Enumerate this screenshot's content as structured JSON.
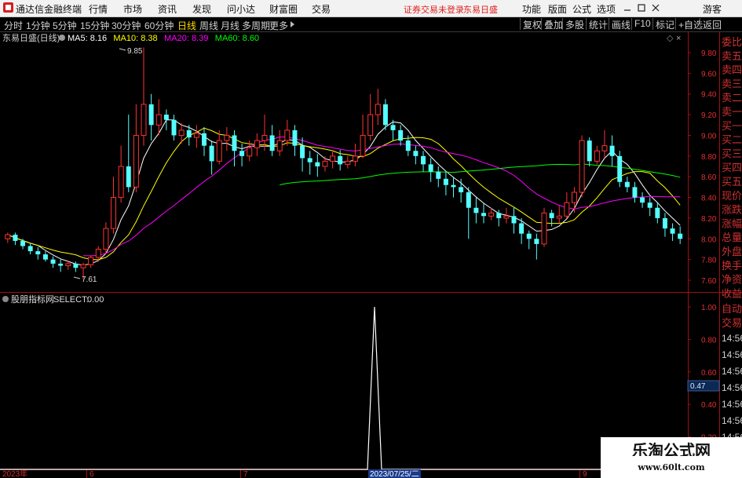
{
  "app": {
    "name": "通达信金融终端",
    "menu": [
      "行情",
      "市场",
      "资讯",
      "发现",
      "问小达",
      "财富圈",
      "交易"
    ],
    "warning": "证券交易未登录",
    "stock_short": "东易日盛",
    "right_menu": [
      "功能",
      "版面",
      "公式",
      "选项"
    ],
    "guest": "游客"
  },
  "toolbar": {
    "periods": [
      "分时",
      "1分钟",
      "5分钟",
      "15分钟",
      "30分钟",
      "60分钟",
      "日线",
      "周线",
      "月线",
      "多周期",
      "更多"
    ],
    "active_period": "日线",
    "buttons": [
      "复权",
      "叠加",
      "多股",
      "统计",
      "画线",
      "F10",
      "标记",
      "+自选",
      "返回"
    ]
  },
  "main_chart": {
    "title": "东易日盛(日线)",
    "ma": [
      {
        "label": "MA5:",
        "value": "8.16",
        "color": "#ffffff"
      },
      {
        "label": "MA10:",
        "value": "8.38",
        "color": "#ffff00"
      },
      {
        "label": "MA20:",
        "value": "8.39",
        "color": "#ff00ff"
      },
      {
        "label": "MA60:",
        "value": "8.60",
        "color": "#00ff00"
      }
    ],
    "high_label": "9.85",
    "low_label": "7.61"
  },
  "sub_chart": {
    "title": "股朋指标网",
    "select_label": "SELECT:",
    "select_value": "0.00",
    "current_value": "0.47"
  },
  "side_panel": {
    "labels": [
      "委比",
      "卖五",
      "卖四",
      "卖三",
      "卖二",
      "卖一",
      "买一",
      "买二",
      "买三",
      "买四",
      "买五",
      "现价",
      "涨跌",
      "涨幅",
      "总量",
      "外盘",
      "换手",
      "净资",
      "收益"
    ],
    "sub_labels": [
      "自动",
      "交易"
    ],
    "times": [
      "14:56",
      "14:56",
      "14:56",
      "14:56",
      "14:56",
      "14:56",
      "14:56",
      "14:56"
    ]
  },
  "x_axis": {
    "ticks": [
      "2023年",
      "6",
      "7",
      "9"
    ],
    "cursor_date": "2023/07/25/二"
  },
  "watermark": {
    "title": "乐淘公式网",
    "url": "www.60lt.com"
  },
  "chart_data": {
    "type": "candlestick",
    "title": "东易日盛(日线)",
    "ylim": [
      7.5,
      10.0
    ],
    "y_ticks": [
      9.8,
      9.6,
      9.4,
      9.2,
      9.0,
      8.8,
      8.6,
      8.4,
      8.2,
      8.0,
      7.8,
      7.6
    ],
    "candles": [
      [
        8.0,
        8.04,
        7.96,
        8.06
      ],
      [
        8.04,
        7.98,
        7.94,
        8.06
      ],
      [
        7.98,
        7.93,
        7.9,
        8.0
      ],
      [
        7.93,
        7.88,
        7.85,
        7.96
      ],
      [
        7.88,
        7.85,
        7.8,
        7.92
      ],
      [
        7.85,
        7.8,
        7.78,
        7.88
      ],
      [
        7.8,
        7.76,
        7.72,
        7.83
      ],
      [
        7.76,
        7.74,
        7.68,
        7.8
      ],
      [
        7.74,
        7.76,
        7.7,
        7.79
      ],
      [
        7.76,
        7.72,
        7.68,
        7.78
      ],
      [
        7.72,
        7.75,
        7.61,
        7.77
      ],
      [
        7.75,
        7.82,
        7.72,
        7.84
      ],
      [
        7.82,
        7.9,
        7.78,
        7.93
      ],
      [
        7.9,
        8.1,
        7.86,
        8.16
      ],
      [
        8.1,
        8.4,
        8.05,
        8.6
      ],
      [
        8.4,
        8.7,
        8.35,
        8.9
      ],
      [
        8.7,
        8.5,
        8.45,
        9.2
      ],
      [
        8.5,
        9.0,
        8.45,
        9.3
      ],
      [
        9.0,
        9.3,
        8.9,
        9.85
      ],
      [
        9.3,
        9.1,
        8.95,
        9.4
      ],
      [
        9.1,
        9.2,
        9.0,
        9.35
      ],
      [
        9.2,
        9.15,
        9.05,
        9.25
      ],
      [
        9.15,
        9.0,
        8.95,
        9.2
      ],
      [
        9.0,
        9.05,
        8.92,
        9.12
      ],
      [
        9.05,
        8.98,
        8.9,
        9.1
      ],
      [
        8.98,
        9.02,
        8.88,
        9.1
      ],
      [
        9.02,
        8.9,
        8.8,
        9.08
      ],
      [
        8.9,
        8.75,
        8.62,
        8.95
      ],
      [
        8.75,
        8.95,
        8.72,
        9.05
      ],
      [
        8.95,
        9.0,
        8.85,
        9.08
      ],
      [
        9.0,
        8.85,
        8.7,
        9.05
      ],
      [
        8.85,
        8.8,
        8.7,
        8.92
      ],
      [
        8.8,
        8.88,
        8.75,
        8.95
      ],
      [
        8.88,
        8.95,
        8.8,
        9.02
      ],
      [
        8.95,
        9.0,
        8.85,
        9.2
      ],
      [
        9.0,
        8.85,
        8.8,
        9.1
      ],
      [
        8.85,
        8.95,
        8.8,
        9.05
      ],
      [
        8.95,
        9.05,
        8.9,
        9.15
      ],
      [
        9.05,
        8.9,
        8.8,
        9.1
      ],
      [
        8.9,
        8.78,
        8.65,
        8.98
      ],
      [
        8.78,
        8.74,
        8.62,
        8.85
      ],
      [
        8.74,
        8.7,
        8.6,
        8.82
      ],
      [
        8.7,
        8.75,
        8.65,
        8.8
      ],
      [
        8.75,
        8.8,
        8.68,
        8.86
      ],
      [
        8.8,
        8.72,
        8.66,
        8.86
      ],
      [
        8.72,
        8.75,
        8.68,
        8.8
      ],
      [
        8.75,
        8.8,
        8.7,
        8.92
      ],
      [
        8.8,
        9.0,
        8.78,
        9.2
      ],
      [
        9.0,
        9.2,
        8.95,
        9.4
      ],
      [
        9.2,
        9.3,
        9.1,
        9.45
      ],
      [
        9.3,
        9.1,
        9.05,
        9.35
      ],
      [
        9.1,
        9.05,
        8.95,
        9.15
      ],
      [
        9.05,
        8.95,
        8.9,
        9.1
      ],
      [
        8.95,
        8.85,
        8.8,
        9.0
      ],
      [
        8.85,
        8.8,
        8.72,
        8.9
      ],
      [
        8.8,
        8.72,
        8.65,
        8.85
      ],
      [
        8.72,
        8.65,
        8.55,
        8.78
      ],
      [
        8.65,
        8.58,
        8.5,
        8.7
      ],
      [
        8.58,
        8.52,
        8.42,
        8.65
      ],
      [
        8.52,
        8.5,
        8.4,
        8.6
      ],
      [
        8.5,
        8.45,
        8.35,
        8.58
      ],
      [
        8.45,
        8.3,
        8.0,
        8.5
      ],
      [
        8.3,
        8.25,
        8.15,
        8.4
      ],
      [
        8.25,
        8.22,
        8.15,
        8.35
      ],
      [
        8.22,
        8.25,
        8.18,
        8.3
      ],
      [
        8.25,
        8.2,
        8.12,
        8.28
      ],
      [
        8.2,
        8.22,
        8.15,
        8.3
      ],
      [
        8.22,
        8.15,
        8.05,
        8.3
      ],
      [
        8.15,
        8.05,
        7.95,
        8.2
      ],
      [
        8.05,
        8.0,
        7.9,
        8.08
      ],
      [
        8.0,
        7.95,
        7.8,
        8.05
      ],
      [
        7.95,
        8.25,
        7.92,
        8.3
      ],
      [
        8.25,
        8.2,
        8.12,
        8.28
      ],
      [
        8.2,
        8.22,
        8.15,
        8.32
      ],
      [
        8.22,
        8.35,
        8.2,
        8.45
      ],
      [
        8.35,
        8.45,
        8.25,
        8.5
      ],
      [
        8.45,
        8.95,
        8.4,
        9.0
      ],
      [
        8.95,
        8.75,
        8.7,
        8.98
      ],
      [
        8.75,
        8.85,
        8.72,
        8.9
      ],
      [
        8.85,
        8.9,
        8.78,
        9.05
      ],
      [
        8.9,
        8.8,
        8.7,
        9.0
      ],
      [
        8.8,
        8.55,
        8.5,
        8.85
      ],
      [
        8.55,
        8.5,
        8.45,
        8.6
      ],
      [
        8.5,
        8.4,
        8.35,
        8.55
      ],
      [
        8.4,
        8.35,
        8.3,
        8.45
      ],
      [
        8.35,
        8.3,
        8.22,
        8.4
      ],
      [
        8.3,
        8.2,
        8.15,
        8.35
      ],
      [
        8.2,
        8.1,
        8.02,
        8.25
      ],
      [
        8.1,
        8.05,
        7.98,
        8.15
      ],
      [
        8.05,
        8.0,
        7.95,
        8.12
      ]
    ],
    "ma_series": [
      "MA5",
      "MA10",
      "MA20",
      "MA60"
    ],
    "sub_indicator": {
      "name": "SELECT",
      "ylim": [
        0,
        1.05
      ],
      "y_ticks": [
        1.0,
        0.8,
        0.6,
        0.4,
        0.2
      ],
      "spike_value": 1.0
    }
  }
}
